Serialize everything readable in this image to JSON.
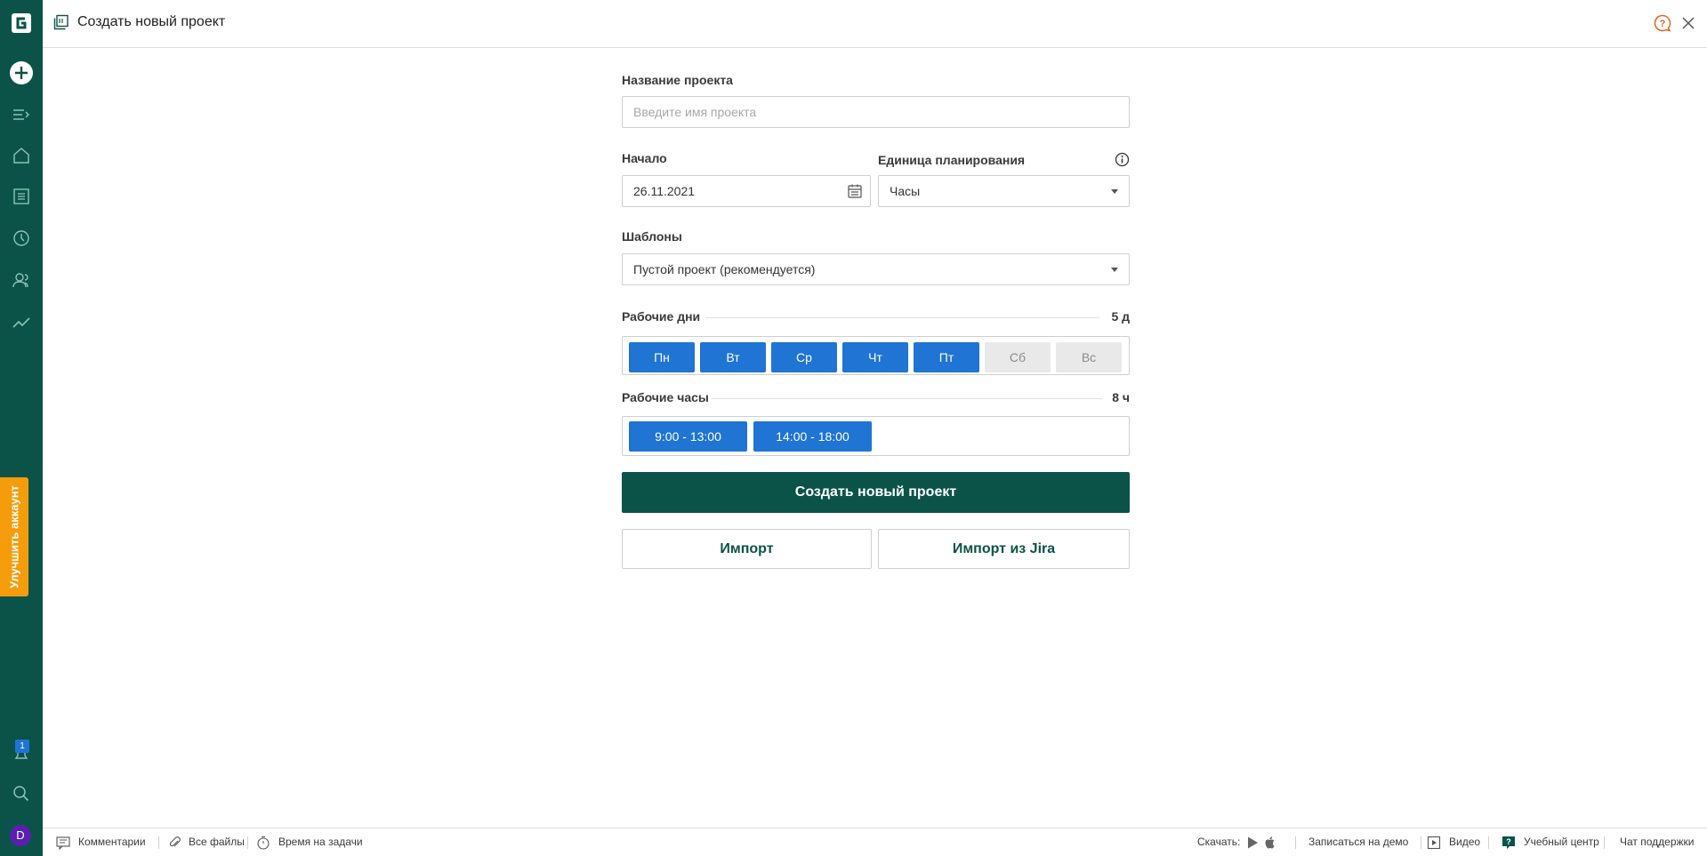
{
  "app": {
    "logo_icon": "gantt-logo-icon",
    "upgrade_label": "Улучшить аккаунт",
    "notification_count": "1",
    "avatar_initial": "D",
    "brand_color": "#0b5348",
    "accent_color": "#1f74d4",
    "upgrade_color": "#f59c0b"
  },
  "sidebar": {
    "items": [
      {
        "icon": "add-icon"
      },
      {
        "icon": "expand-menu-icon"
      },
      {
        "icon": "home-icon"
      },
      {
        "icon": "list-icon"
      },
      {
        "icon": "clock-icon"
      },
      {
        "icon": "users-icon"
      },
      {
        "icon": "trend-icon"
      },
      {
        "icon": "notification-icon"
      },
      {
        "icon": "search-icon"
      }
    ]
  },
  "header": {
    "title": "Создать новый проект"
  },
  "form": {
    "name_label": "Название проекта",
    "name_placeholder": "Введите имя проекта",
    "name_value": "",
    "start_label": "Начало",
    "start_value": "26.11.2021",
    "unit_label": "Единица планирования",
    "unit_value": "Часы",
    "templates_label": "Шаблоны",
    "templates_value": "Пустой проект (рекомендуется)",
    "workdays_label": "Рабочие дни",
    "workdays_count": "5 д",
    "days": [
      {
        "label": "Пн",
        "active": true
      },
      {
        "label": "Вт",
        "active": true
      },
      {
        "label": "Ср",
        "active": true
      },
      {
        "label": "Чт",
        "active": true
      },
      {
        "label": "Пт",
        "active": true
      },
      {
        "label": "Сб",
        "active": false
      },
      {
        "label": "Вс",
        "active": false
      }
    ],
    "workhours_label": "Рабочие часы",
    "workhours_count": "8 ч",
    "slots": [
      "9:00 - 13:00",
      "14:00 - 18:00"
    ],
    "create_button": "Создать новый проект",
    "import_button": "Импорт",
    "import_jira_button": "Импорт из Jira"
  },
  "footer": {
    "comments": "Комментарии",
    "files": "Все файлы",
    "time": "Время на задачи",
    "download": "Скачать:",
    "demo": "Записаться на демо",
    "video": "Видео",
    "learning": "Учебный центр",
    "support": "Чат поддержки"
  }
}
